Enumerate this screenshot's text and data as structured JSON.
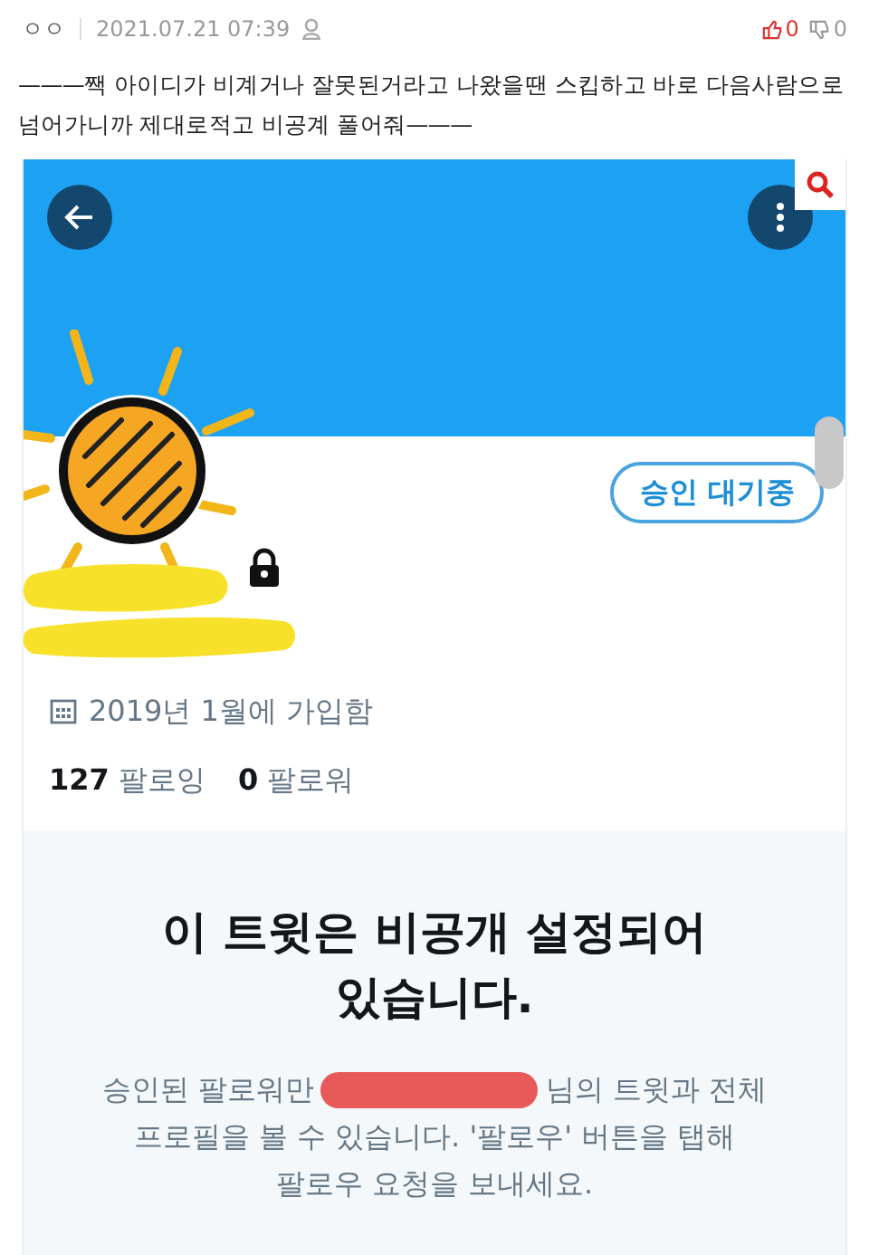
{
  "post": {
    "author": "ㅇㅇ",
    "date": "2021.07.21 07:39",
    "likes": "0",
    "dislikes": "0",
    "text": "———짹 아이디가 비계거나 잘못된거라고 나왔을땐 스킵하고 바로 다음사람으로 넘어가니까 제대로적고 비공계 풀어줘———"
  },
  "profile": {
    "status_button": "승인 대기중",
    "joined": "2019년 1월에 가입함",
    "following_count": "127",
    "following_label": "팔로잉",
    "followers_count": "0",
    "followers_label": "팔로워"
  },
  "notice": {
    "title": "이 트윗은 비공개 설정되어 있습니다.",
    "body_before": "승인된 팔로워만",
    "body_lines": [
      "님의 트윗과 전체",
      "프로필을 볼 수 있습니다. '팔로우' 버튼을 탭해",
      "팔로우 요청을 보내세요."
    ]
  }
}
